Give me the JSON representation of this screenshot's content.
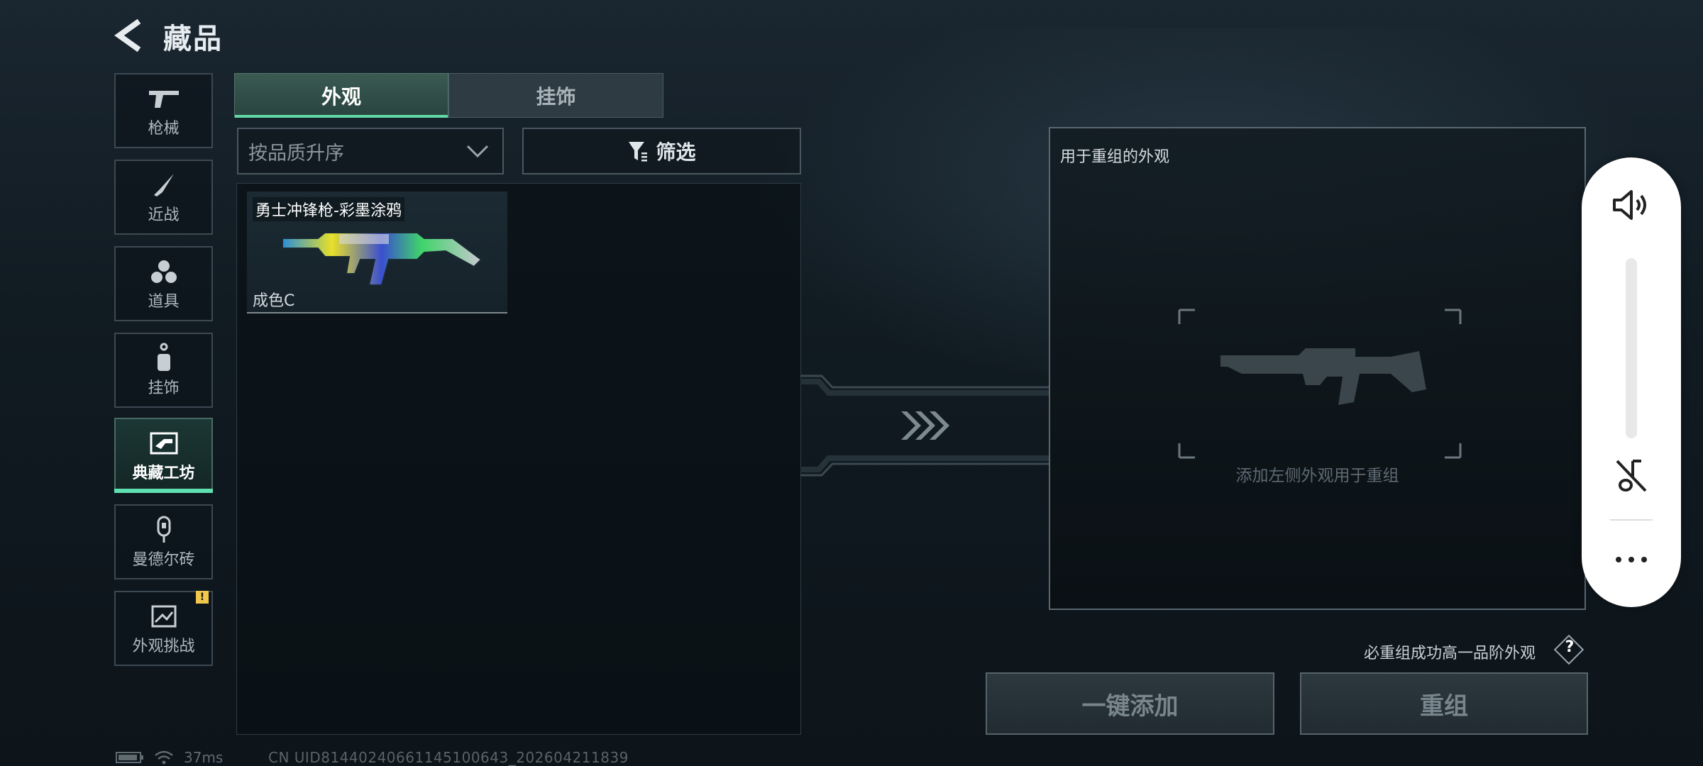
{
  "header": {
    "title": "藏品",
    "back_icon": "back-arrow-icon"
  },
  "nav": [
    {
      "label": "枪械",
      "icon": "gun-icon",
      "active": false
    },
    {
      "label": "近战",
      "icon": "knife-icon",
      "active": false
    },
    {
      "label": "道具",
      "icon": "grenade-icon",
      "active": false
    },
    {
      "label": "挂饰",
      "icon": "charm-icon",
      "active": false
    },
    {
      "label": "典藏工坊",
      "icon": "workshop-icon",
      "active": true
    },
    {
      "label": "曼德尔砖",
      "icon": "mandel-brick-icon",
      "active": false
    },
    {
      "label": "外观挑战",
      "icon": "challenge-icon",
      "active": false,
      "badge": "!"
    }
  ],
  "tabs": [
    {
      "label": "外观",
      "active": true
    },
    {
      "label": "挂饰",
      "active": false
    }
  ],
  "sort": {
    "value": "按品质升序"
  },
  "filter": {
    "label": "筛选"
  },
  "items": [
    {
      "name": "勇士冲锋枪-彩墨涂鸦",
      "condition": "成色C"
    }
  ],
  "recombine": {
    "title": "用于重组的外观",
    "placeholder": "添加左侧外观用于重组"
  },
  "note": "必重组成功高一品阶外观",
  "help": "?",
  "buttons": {
    "add_all": "一键添加",
    "recombine": "重组"
  },
  "status": {
    "ping": "37ms",
    "uid": "CN UID8144024066114510064​3_202604211839"
  },
  "colors": {
    "accent": "#5ee0b0",
    "badge": "#f0c74a"
  }
}
